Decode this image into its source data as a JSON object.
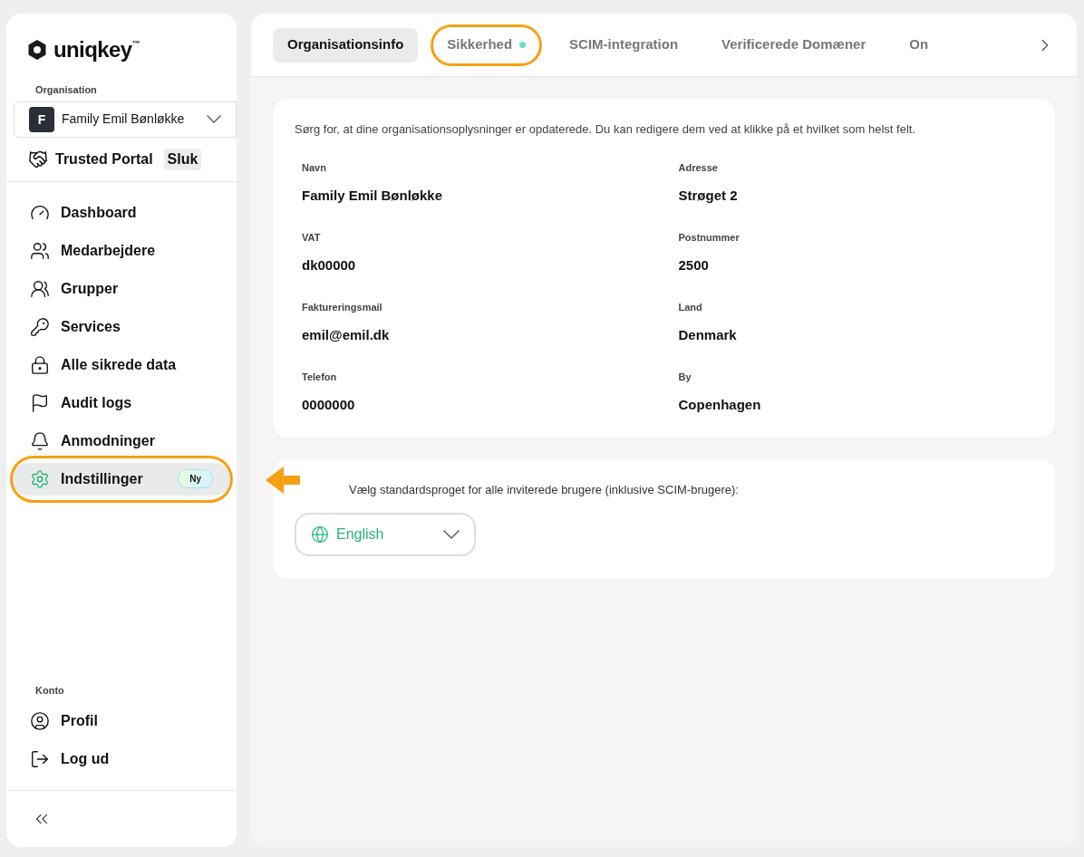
{
  "sidebar": {
    "logo": "uniqkey",
    "logo_mark": "™",
    "organisation": {
      "label": "Organisation",
      "initial": "F",
      "name": "Family Emil Bønløkke"
    },
    "trusted_portal": {
      "label": "Trusted Portal",
      "badge": "Sluk"
    },
    "items": [
      {
        "label": "Dashboard",
        "selected": false,
        "highlighted": false
      },
      {
        "label": "Medarbejdere",
        "selected": false,
        "highlighted": false
      },
      {
        "label": "Grupper",
        "selected": false,
        "highlighted": false
      },
      {
        "label": "Services",
        "selected": false,
        "highlighted": false
      },
      {
        "label": "Alle sikrede data",
        "selected": false,
        "highlighted": false
      },
      {
        "label": "Audit logs",
        "selected": false,
        "highlighted": false
      },
      {
        "label": "Anmodninger",
        "selected": false,
        "highlighted": false
      },
      {
        "label": "Indstillinger",
        "selected": true,
        "highlighted": true,
        "badge": "Ny"
      }
    ],
    "account_label": "Konto",
    "account_items": [
      {
        "label": "Profil"
      },
      {
        "label": "Log ud"
      }
    ]
  },
  "tabs": [
    {
      "label": "Organisationsinfo",
      "selected": true,
      "highlighted": false,
      "dot": false
    },
    {
      "label": "Sikkerhed",
      "selected": false,
      "highlighted": true,
      "dot": true
    },
    {
      "label": "SCIM-integration",
      "selected": false,
      "highlighted": false,
      "dot": false
    },
    {
      "label": "Verificerede Domæner",
      "selected": false,
      "highlighted": false,
      "dot": false
    },
    {
      "label": "On",
      "selected": false,
      "highlighted": false,
      "dot": false
    }
  ],
  "info_card": {
    "intro": "Sørg for, at dine organisationsoplysninger er opdaterede. Du kan redigere dem ved at klikke på et hvilket som helst felt.",
    "fields": [
      {
        "label": "Navn",
        "value": "Family Emil Bønløkke"
      },
      {
        "label": "Adresse",
        "value": "Strøget 2"
      },
      {
        "label": "VAT",
        "value": "dk00000"
      },
      {
        "label": "Postnummer",
        "value": "2500"
      },
      {
        "label": "Faktureringsmail",
        "value": "emil@emil.dk"
      },
      {
        "label": "Land",
        "value": "Denmark"
      },
      {
        "label": "Telefon",
        "value": "0000000"
      },
      {
        "label": "By",
        "value": "Copenhagen"
      }
    ]
  },
  "language_card": {
    "text": "Vælg standardsproget for alle inviterede brugere (inklusive SCIM-brugere):",
    "value": "English"
  }
}
